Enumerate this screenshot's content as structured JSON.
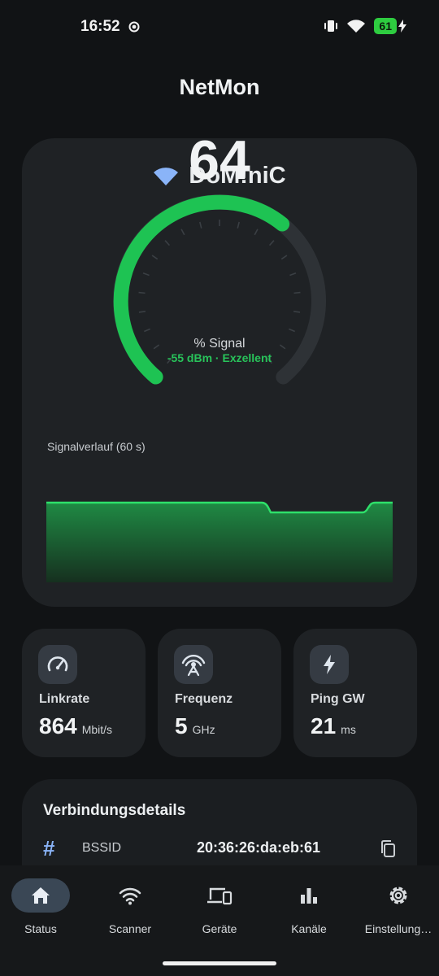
{
  "status_bar": {
    "time": "16:52",
    "battery": "61"
  },
  "app": {
    "title": "NetMon"
  },
  "network": {
    "ssid": "DoM!niC"
  },
  "gauge": {
    "value": "64",
    "value_fraction": 0.64,
    "unit": "% Signal",
    "sub": "-55 dBm · Exzellent"
  },
  "history": {
    "label": "Signalverlauf (60 s)"
  },
  "tiles": [
    {
      "label": "Linkrate",
      "value": "864",
      "unit": "Mbit/s",
      "icon": "speedometer-icon"
    },
    {
      "label": "Frequenz",
      "value": "5",
      "unit": "GHz",
      "icon": "antenna-icon"
    },
    {
      "label": "Ping GW",
      "value": "21",
      "unit": "ms",
      "icon": "bolt-icon"
    }
  ],
  "details": {
    "title": "Verbindungsdetails",
    "rows": [
      {
        "key": "BSSID",
        "value": "20:36:26:da:eb:61"
      }
    ]
  },
  "nav": [
    {
      "label": "Status",
      "icon": "home-icon"
    },
    {
      "label": "Scanner",
      "icon": "wifi-icon"
    },
    {
      "label": "Geräte",
      "icon": "devices-icon"
    },
    {
      "label": "Kanäle",
      "icon": "bar-chart-icon"
    },
    {
      "label": "Einstellung…",
      "icon": "gear-icon"
    }
  ],
  "colors": {
    "accent": "#28c35a",
    "card": "#1f2225",
    "background": "#111315"
  }
}
